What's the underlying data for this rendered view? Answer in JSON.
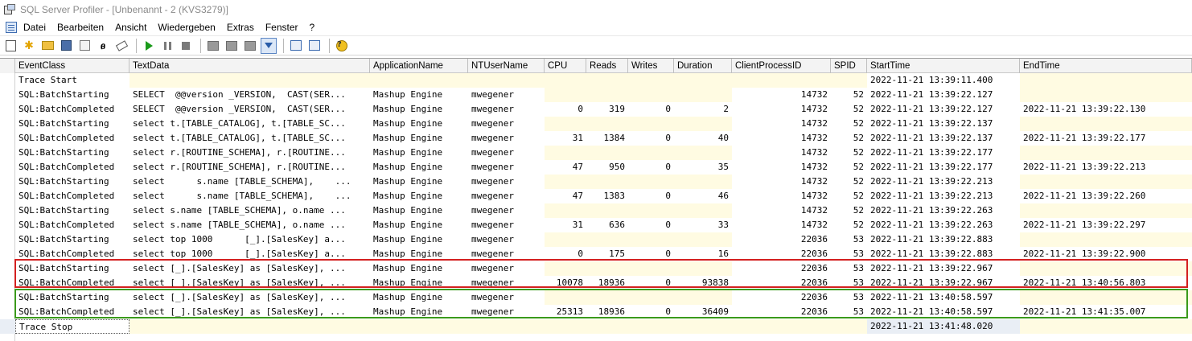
{
  "window": {
    "title": "SQL Server Profiler - [Unbenannt - 2 (KVS3279)]",
    "icon": "profiler-app-icon"
  },
  "menu": {
    "items": [
      "Datei",
      "Bearbeiten",
      "Ansicht",
      "Wiedergeben",
      "Extras",
      "Fenster",
      "?"
    ]
  },
  "toolbar": {
    "buttons": [
      {
        "name": "new-trace-icon"
      },
      {
        "name": "new-template-icon"
      },
      {
        "name": "open-icon"
      },
      {
        "name": "save-icon"
      },
      {
        "name": "properties-icon"
      },
      {
        "name": "find-icon",
        "glyph": "₼"
      },
      {
        "name": "clear-icon"
      },
      {
        "name": "run-icon"
      },
      {
        "name": "pause-icon"
      },
      {
        "name": "stop-icon"
      },
      {
        "name": "template-list-icon"
      },
      {
        "name": "properties-list-icon"
      },
      {
        "name": "schema-icon"
      },
      {
        "name": "autoscroll-icon"
      },
      {
        "name": "activity-monitor-icon"
      },
      {
        "name": "perfmon-icon"
      },
      {
        "name": "help-icon",
        "glyph": "?"
      }
    ]
  },
  "columns": [
    "EventClass",
    "TextData",
    "ApplicationName",
    "NTUserName",
    "CPU",
    "Reads",
    "Writes",
    "Duration",
    "ClientProcessID",
    "SPID",
    "StartTime",
    "EndTime"
  ],
  "rows": [
    {
      "EventClass": "Trace Start",
      "TextData": "",
      "ApplicationName": "",
      "NTUserName": "",
      "CPU": "",
      "Reads": "",
      "Writes": "",
      "Duration": "",
      "ClientProcessID": "",
      "SPID": "",
      "StartTime": "2022-11-21 13:39:11.400",
      "EndTime": ""
    },
    {
      "EventClass": "SQL:BatchStarting",
      "TextData": "SELECT  @@version _VERSION,  CAST(SER...",
      "ApplicationName": "Mashup Engine",
      "NTUserName": "mwegener",
      "CPU": "",
      "Reads": "",
      "Writes": "",
      "Duration": "",
      "ClientProcessID": "14732",
      "SPID": "52",
      "StartTime": "2022-11-21 13:39:22.127",
      "EndTime": ""
    },
    {
      "EventClass": "SQL:BatchCompleted",
      "TextData": "SELECT  @@version _VERSION,  CAST(SER...",
      "ApplicationName": "Mashup Engine",
      "NTUserName": "mwegener",
      "CPU": "0",
      "Reads": "319",
      "Writes": "0",
      "Duration": "2",
      "ClientProcessID": "14732",
      "SPID": "52",
      "StartTime": "2022-11-21 13:39:22.127",
      "EndTime": "2022-11-21 13:39:22.130"
    },
    {
      "EventClass": "SQL:BatchStarting",
      "TextData": "select t.[TABLE_CATALOG], t.[TABLE_SC...",
      "ApplicationName": "Mashup Engine",
      "NTUserName": "mwegener",
      "CPU": "",
      "Reads": "",
      "Writes": "",
      "Duration": "",
      "ClientProcessID": "14732",
      "SPID": "52",
      "StartTime": "2022-11-21 13:39:22.137",
      "EndTime": ""
    },
    {
      "EventClass": "SQL:BatchCompleted",
      "TextData": "select t.[TABLE_CATALOG], t.[TABLE_SC...",
      "ApplicationName": "Mashup Engine",
      "NTUserName": "mwegener",
      "CPU": "31",
      "Reads": "1384",
      "Writes": "0",
      "Duration": "40",
      "ClientProcessID": "14732",
      "SPID": "52",
      "StartTime": "2022-11-21 13:39:22.137",
      "EndTime": "2022-11-21 13:39:22.177"
    },
    {
      "EventClass": "SQL:BatchStarting",
      "TextData": "select r.[ROUTINE_SCHEMA], r.[ROUTINE...",
      "ApplicationName": "Mashup Engine",
      "NTUserName": "mwegener",
      "CPU": "",
      "Reads": "",
      "Writes": "",
      "Duration": "",
      "ClientProcessID": "14732",
      "SPID": "52",
      "StartTime": "2022-11-21 13:39:22.177",
      "EndTime": ""
    },
    {
      "EventClass": "SQL:BatchCompleted",
      "TextData": "select r.[ROUTINE_SCHEMA], r.[ROUTINE...",
      "ApplicationName": "Mashup Engine",
      "NTUserName": "mwegener",
      "CPU": "47",
      "Reads": "950",
      "Writes": "0",
      "Duration": "35",
      "ClientProcessID": "14732",
      "SPID": "52",
      "StartTime": "2022-11-21 13:39:22.177",
      "EndTime": "2022-11-21 13:39:22.213"
    },
    {
      "EventClass": "SQL:BatchStarting",
      "TextData": "select      s.name [TABLE_SCHEMA],    ...",
      "ApplicationName": "Mashup Engine",
      "NTUserName": "mwegener",
      "CPU": "",
      "Reads": "",
      "Writes": "",
      "Duration": "",
      "ClientProcessID": "14732",
      "SPID": "52",
      "StartTime": "2022-11-21 13:39:22.213",
      "EndTime": ""
    },
    {
      "EventClass": "SQL:BatchCompleted",
      "TextData": "select      s.name [TABLE_SCHEMA],    ...",
      "ApplicationName": "Mashup Engine",
      "NTUserName": "mwegener",
      "CPU": "47",
      "Reads": "1383",
      "Writes": "0",
      "Duration": "46",
      "ClientProcessID": "14732",
      "SPID": "52",
      "StartTime": "2022-11-21 13:39:22.213",
      "EndTime": "2022-11-21 13:39:22.260"
    },
    {
      "EventClass": "SQL:BatchStarting",
      "TextData": "select s.name [TABLE_SCHEMA], o.name ...",
      "ApplicationName": "Mashup Engine",
      "NTUserName": "mwegener",
      "CPU": "",
      "Reads": "",
      "Writes": "",
      "Duration": "",
      "ClientProcessID": "14732",
      "SPID": "52",
      "StartTime": "2022-11-21 13:39:22.263",
      "EndTime": ""
    },
    {
      "EventClass": "SQL:BatchCompleted",
      "TextData": "select s.name [TABLE_SCHEMA], o.name ...",
      "ApplicationName": "Mashup Engine",
      "NTUserName": "mwegener",
      "CPU": "31",
      "Reads": "636",
      "Writes": "0",
      "Duration": "33",
      "ClientProcessID": "14732",
      "SPID": "52",
      "StartTime": "2022-11-21 13:39:22.263",
      "EndTime": "2022-11-21 13:39:22.297"
    },
    {
      "EventClass": "SQL:BatchStarting",
      "TextData": "select top 1000      [_].[SalesKey] a...",
      "ApplicationName": "Mashup Engine",
      "NTUserName": "mwegener",
      "CPU": "",
      "Reads": "",
      "Writes": "",
      "Duration": "",
      "ClientProcessID": "22036",
      "SPID": "53",
      "StartTime": "2022-11-21 13:39:22.883",
      "EndTime": ""
    },
    {
      "EventClass": "SQL:BatchCompleted",
      "TextData": "select top 1000      [_].[SalesKey] a...",
      "ApplicationName": "Mashup Engine",
      "NTUserName": "mwegener",
      "CPU": "0",
      "Reads": "175",
      "Writes": "0",
      "Duration": "16",
      "ClientProcessID": "22036",
      "SPID": "53",
      "StartTime": "2022-11-21 13:39:22.883",
      "EndTime": "2022-11-21 13:39:22.900"
    },
    {
      "EventClass": "SQL:BatchStarting",
      "TextData": "select [_].[SalesKey] as [SalesKey], ...",
      "ApplicationName": "Mashup Engine",
      "NTUserName": "mwegener",
      "CPU": "",
      "Reads": "",
      "Writes": "",
      "Duration": "",
      "ClientProcessID": "22036",
      "SPID": "53",
      "StartTime": "2022-11-21 13:39:22.967",
      "EndTime": ""
    },
    {
      "EventClass": "SQL:BatchCompleted",
      "TextData": "select [_].[SalesKey] as [SalesKey], ...",
      "ApplicationName": "Mashup Engine",
      "NTUserName": "mwegener",
      "CPU": "10078",
      "Reads": "18936",
      "Writes": "0",
      "Duration": "93838",
      "ClientProcessID": "22036",
      "SPID": "53",
      "StartTime": "2022-11-21 13:39:22.967",
      "EndTime": "2022-11-21 13:40:56.803"
    },
    {
      "EventClass": "SQL:BatchStarting",
      "TextData": "select [_].[SalesKey] as [SalesKey], ...",
      "ApplicationName": "Mashup Engine",
      "NTUserName": "mwegener",
      "CPU": "",
      "Reads": "",
      "Writes": "",
      "Duration": "",
      "ClientProcessID": "22036",
      "SPID": "53",
      "StartTime": "2022-11-21 13:40:58.597",
      "EndTime": ""
    },
    {
      "EventClass": "SQL:BatchCompleted",
      "TextData": "select [_].[SalesKey] as [SalesKey], ...",
      "ApplicationName": "Mashup Engine",
      "NTUserName": "mwegener",
      "CPU": "25313",
      "Reads": "18936",
      "Writes": "0",
      "Duration": "36409",
      "ClientProcessID": "22036",
      "SPID": "53",
      "StartTime": "2022-11-21 13:40:58.597",
      "EndTime": "2022-11-21 13:41:35.007"
    },
    {
      "EventClass": "Trace Stop",
      "TextData": "",
      "ApplicationName": "",
      "NTUserName": "",
      "CPU": "",
      "Reads": "",
      "Writes": "",
      "Duration": "",
      "ClientProcessID": "",
      "SPID": "",
      "StartTime": "2022-11-21 13:41:48.020",
      "EndTime": ""
    }
  ],
  "highlights": {
    "red_color": "#d42020",
    "green_color": "#3a9a1a"
  }
}
